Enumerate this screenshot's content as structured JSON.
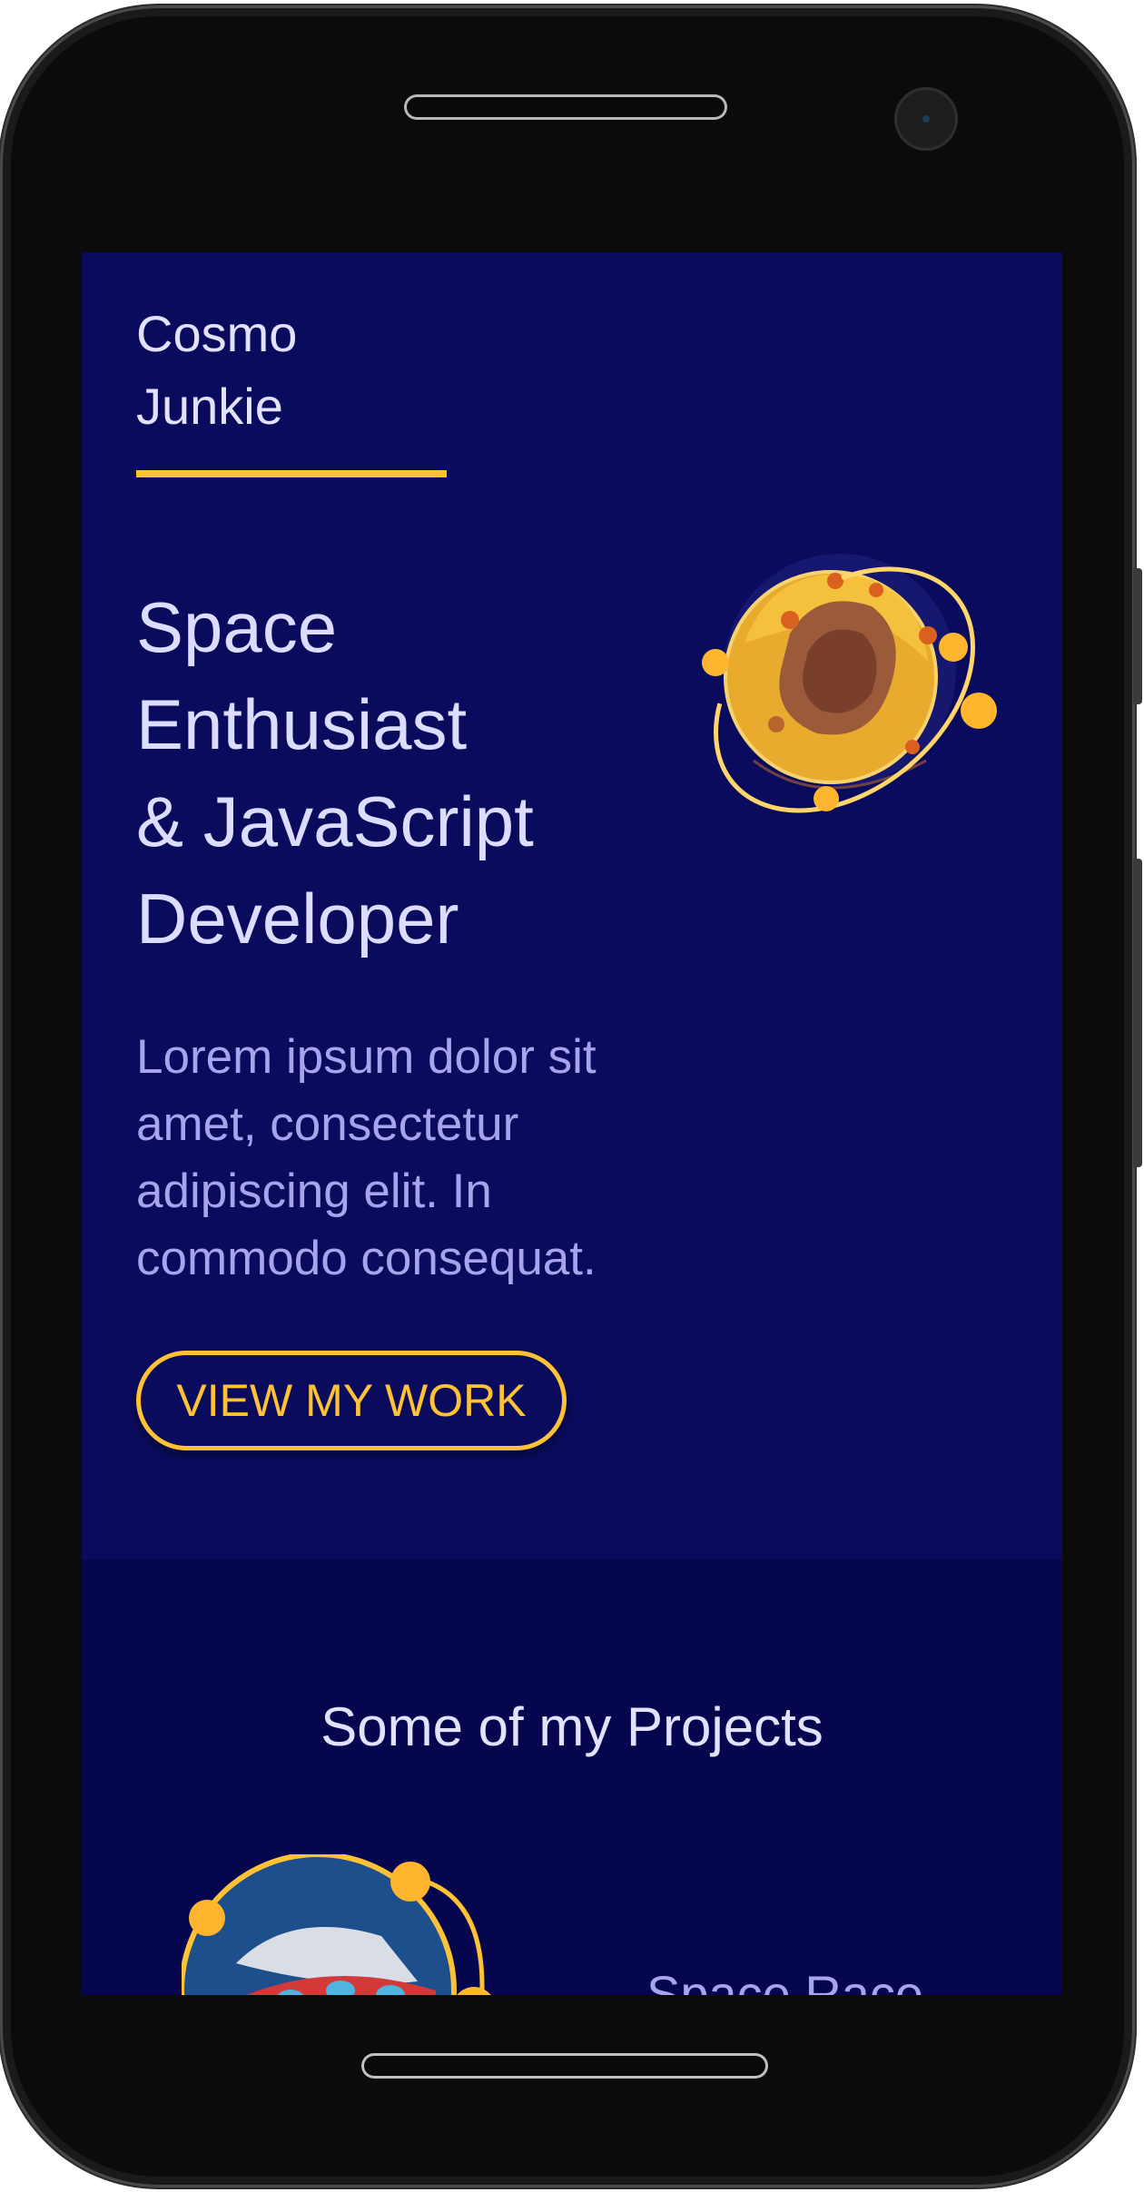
{
  "brand": {
    "line1": "Cosmo",
    "line2": "Junkie"
  },
  "hero": {
    "headline": [
      "Space",
      "Enthusiast",
      "& JavaScript",
      "Developer"
    ],
    "lede": "Lorem ipsum dolor sit amet, consectetur adipiscing elit. In commodo consequat.",
    "cta_label": "VIEW MY WORK"
  },
  "projects": {
    "title": "Some of my Projects",
    "items": [
      {
        "title": "Space Race",
        "thumbnail_icon": "rocket-planet-icon"
      }
    ]
  },
  "icons": {
    "hero_illustration": "planet-icon",
    "camera": "front-camera-icon"
  },
  "colors": {
    "hero_bg": "#0a0b5c",
    "projects_bg": "#05064e",
    "accent": "#ffc235",
    "headline_text": "#dcdcff",
    "body_text": "#a7a3ec",
    "device_frame": "#0b0b0b"
  }
}
